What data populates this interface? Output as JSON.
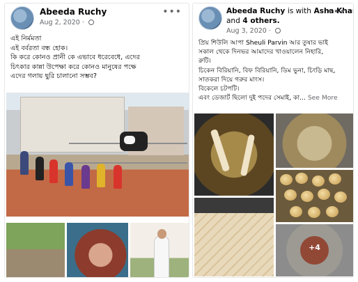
{
  "posts": [
    {
      "author": "Abeeda Ruchy",
      "date": "Aug 2, 2020",
      "more": "•••",
      "text_lines": [
        "এই নির্মমতা",
        "এই বর্বরতা বন্ধ হোক।",
        "কি করে কোনও প্রানী কে এভাবে ধরেবেধে, এদের",
        "চিৎকার কান্না উপেক্ষা করে কোনও মানুষের পক্ষে",
        "এদের গলায় ছুরি চালানো সম্ভব?"
      ]
    },
    {
      "author": "Abeeda Ruchy",
      "with_text": "is with",
      "tagged": "Asha Khan",
      "and_text": "and",
      "others": "4 others.",
      "date": "Aug 3, 2020",
      "more": "•••",
      "text_lines": [
        "প্রিয় শিউলি আপা Sheuli Parvin আর তুষার ভাই",
        "সকাল থেকে দিনভর আমাদের খাওয়ালেন নিহারি,",
        "রুটি।",
        "চিকেন বিরিয়ানি, বিফ বিরিয়ানি, ডিম ভুনা, চিংড়ি মাছ,",
        "সাতকরা দিয়ে গরুর মাংস।",
        "বিকেলে চটপটি।"
      ],
      "last_line": "এবং ডেজার্ট ছিলো দুই পদের সেমাই, কা...",
      "see_more": "See More",
      "extra_photos": "+4"
    }
  ]
}
